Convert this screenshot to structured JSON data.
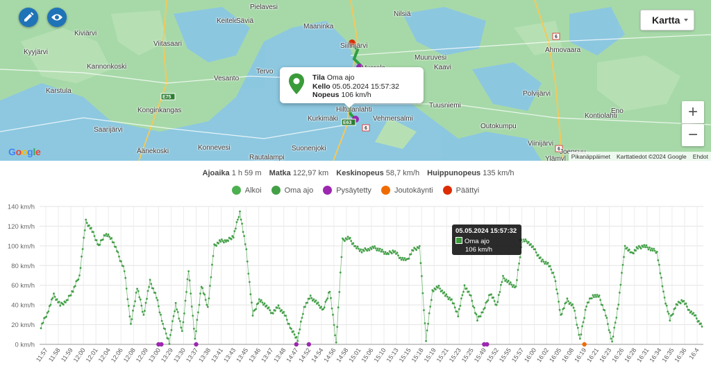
{
  "map": {
    "type_select": "Kartta",
    "zoom_in": "+",
    "zoom_out": "−",
    "google": "Google",
    "attribution": [
      "Pikanäppäimet",
      "Karttatiedot ©2024 Google",
      "Ehdot"
    ],
    "places": [
      "Pielavesi",
      "Keitele",
      "Säviä",
      "Maaninka",
      "Nilsiä",
      "Kiviärvi",
      "Viitasaari",
      "Siilinjärvi",
      "Muuruvesi",
      "Ahmovaara",
      "Joensuu",
      "Kyyjärvi",
      "Kannonkoski",
      "Tervo",
      "Vuorela",
      "Kaavi",
      "Karstula",
      "Vesanto",
      "Polvijärvi",
      "Konginkangas",
      "Hiltulanlahti",
      "Tuusniemi",
      "Kontiolahti",
      "Saarijärvi",
      "Kurkimäki",
      "Vehmersalmi",
      "Outokumpu",
      "Eno",
      "Äänekoski",
      "Konnevesi",
      "Rautalampi",
      "Suonenjoki",
      "Viinijärvi",
      "Ylämyl"
    ],
    "road_labels": [
      "E75",
      "E63",
      "6",
      "6",
      "6"
    ],
    "popup": {
      "tila_label": "Tila",
      "tila_value": "Oma ajo",
      "kello_label": "Kello",
      "kello_value": "05.05.2024 15:57:32",
      "nopeus_label": "Nopeus",
      "nopeus_value": "106 km/h"
    }
  },
  "stats": {
    "ajoaika_label": "Ajoaika",
    "ajoaika_value": "1 h 59 m",
    "matka_label": "Matka",
    "matka_value": "122,97 km",
    "keskinopeus_label": "Keskinopeus",
    "keskinopeus_value": "58,7 km/h",
    "huippunopeus_label": "Huippunopeus",
    "huippunopeus_value": "135 km/h"
  },
  "legend": [
    {
      "label": "Alkoi",
      "color": "#4caf50"
    },
    {
      "label": "Oma ajo",
      "color": "#43a047"
    },
    {
      "label": "Pysäytetty",
      "color": "#9c27b0"
    },
    {
      "label": "Joutokäynti",
      "color": "#ef6c00"
    },
    {
      "label": "Päättyi",
      "color": "#dd2c00"
    }
  ],
  "tooltip": {
    "title": "05.05.2024 15:57:32",
    "series": "Oma ajo",
    "value": "106 km/h"
  },
  "chart_data": {
    "type": "line",
    "ylabel_unit": "km/h",
    "ylim": [
      0,
      140
    ],
    "yticks": [
      "0 km/h",
      "20 km/h",
      "40 km/h",
      "60 km/h",
      "80 km/h",
      "100 km/h",
      "120 km/h",
      "140 km/h"
    ],
    "x": [
      "11:57",
      "11:58",
      "11:59",
      "12:00",
      "12:01",
      "12:04",
      "12:06",
      "12:08",
      "12:09",
      "13:00",
      "13:29",
      "13:30",
      "13:37",
      "13:38",
      "13:41",
      "13:43",
      "13:45",
      "13:46",
      "13:47",
      "13:48",
      "14:47",
      "14:52",
      "14:54",
      "14:56",
      "14:58",
      "15:01",
      "15:06",
      "15:10",
      "15:13",
      "15:15",
      "15:18",
      "15:19",
      "15:21",
      "15:23",
      "15:25",
      "15:49",
      "15:52",
      "15:55",
      "15:57",
      "16:00",
      "16:02",
      "16:05",
      "16:08",
      "16:19",
      "16:21",
      "16:23",
      "16:26",
      "16:28",
      "16:31",
      "16:34",
      "16:35",
      "16:36",
      "16:4"
    ],
    "series": [
      {
        "name": "Oma ajo",
        "color": "#43a047",
        "values": [
          18,
          32,
          50,
          40,
          44,
          55,
          70,
          125,
          115,
          100,
          112,
          108,
          92,
          75,
          20,
          58,
          30,
          64,
          48,
          20,
          2,
          42,
          12,
          75,
          5,
          60,
          38,
          100,
          105,
          105,
          110,
          135,
          95,
          30,
          45,
          40,
          32,
          38,
          30,
          15,
          5,
          38,
          48,
          42,
          35,
          55,
          2,
          106,
          108,
          99,
          95,
          97,
          98,
          95,
          92,
          95,
          88,
          85,
          96,
          99,
          5,
          55,
          58,
          50,
          45,
          30,
          60,
          48,
          25,
          35,
          52,
          40,
          68,
          62,
          58,
          106,
          104,
          95,
          85,
          82,
          70,
          30,
          45,
          38,
          5,
          40,
          50,
          48,
          30,
          2,
          42,
          100,
          92,
          98,
          100,
          97,
          94,
          52,
          25,
          40,
          45,
          35,
          28,
          18
        ]
      }
    ],
    "events": [
      {
        "type": "Pysäytetty",
        "x": [
          "13:00",
          "13:00",
          "13:37",
          "14:47",
          "14:52",
          "15:49",
          "15:49"
        ]
      },
      {
        "type": "Joutokäynti",
        "x": [
          "16:19"
        ]
      }
    ],
    "grid": true,
    "legend_position": "top"
  }
}
